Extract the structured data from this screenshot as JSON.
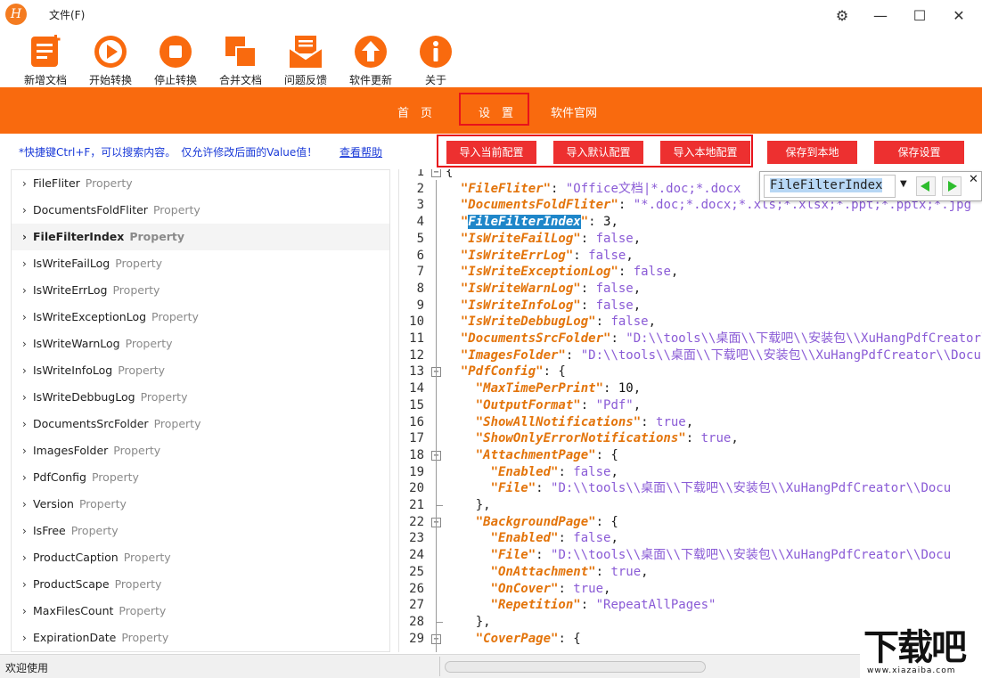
{
  "app": {
    "logo_letter": "H",
    "menu_file": "文件(F)"
  },
  "window": {
    "settings_glyph": "⚙",
    "minimize_glyph": "—",
    "maximize_glyph": "☐",
    "close_glyph": "✕"
  },
  "toolbar": {
    "items": [
      {
        "label": "新增文档",
        "icon": "new-doc-icon"
      },
      {
        "label": "开始转换",
        "icon": "play-icon"
      },
      {
        "label": "停止转换",
        "icon": "stop-icon"
      },
      {
        "label": "合并文档",
        "icon": "merge-icon"
      },
      {
        "label": "问题反馈",
        "icon": "feedback-icon"
      },
      {
        "label": "软件更新",
        "icon": "update-icon"
      },
      {
        "label": "关于",
        "icon": "info-icon"
      }
    ],
    "accent": "#f96a0e"
  },
  "nav": {
    "home": "首　页",
    "settings": "设　置",
    "website": "软件官网"
  },
  "info": {
    "hint": "*快捷键Ctrl+F，可以搜索内容。　仅允许修改后面的Value值！",
    "help_link": "查看帮助"
  },
  "buttons": {
    "import_current": "导入当前配置",
    "import_default": "导入默认配置",
    "import_local": "导入本地配置",
    "save_local": "保存到本地",
    "save_settings": "保存设置",
    "color": "#ed3030"
  },
  "properties": {
    "type_label": "Property",
    "chevron": "›",
    "selected_index": 2,
    "items": [
      "FileFliter",
      "DocumentsFoldFliter",
      "FileFilterIndex",
      "IsWriteFailLog",
      "IsWriteErrLog",
      "IsWriteExceptionLog",
      "IsWriteWarnLog",
      "IsWriteInfoLog",
      "IsWriteDebbugLog",
      "DocumentsSrcFolder",
      "ImagesFolder",
      "PdfConfig",
      "Version",
      "IsFree",
      "ProductCaption",
      "ProductScape",
      "MaxFilesCount",
      "ExpirationDate"
    ]
  },
  "editor": {
    "lines": [
      {
        "n": "1",
        "fold": "minus",
        "parts": [
          [
            "p",
            "{"
          ]
        ]
      },
      {
        "n": "2",
        "parts": [
          [
            "p",
            "  "
          ],
          [
            "k",
            "\"FileFliter\""
          ],
          [
            "p",
            ": "
          ],
          [
            "s",
            "\"Office文档|*.doc;*.docx"
          ]
        ]
      },
      {
        "n": "3",
        "parts": [
          [
            "p",
            "  "
          ],
          [
            "k",
            "\"DocumentsFoldFliter\""
          ],
          [
            "p",
            ": "
          ],
          [
            "s",
            "\"*.doc;*.docx;*.xls;*.xlsx;*.ppt;*.pptx;*.jpg"
          ]
        ]
      },
      {
        "n": "4",
        "parts": [
          [
            "p",
            "  "
          ],
          [
            "k",
            "\""
          ],
          [
            "h",
            "FileFilterIndex"
          ],
          [
            "k",
            "\""
          ],
          [
            "p",
            ": "
          ],
          [
            "n",
            "3"
          ],
          [
            "p",
            ","
          ]
        ]
      },
      {
        "n": "5",
        "parts": [
          [
            "p",
            "  "
          ],
          [
            "k",
            "\"IsWriteFailLog\""
          ],
          [
            "p",
            ": "
          ],
          [
            "w",
            "false"
          ],
          [
            "p",
            ","
          ]
        ]
      },
      {
        "n": "6",
        "parts": [
          [
            "p",
            "  "
          ],
          [
            "k",
            "\"IsWriteErrLog\""
          ],
          [
            "p",
            ": "
          ],
          [
            "w",
            "false"
          ],
          [
            "p",
            ","
          ]
        ]
      },
      {
        "n": "7",
        "parts": [
          [
            "p",
            "  "
          ],
          [
            "k",
            "\"IsWriteExceptionLog\""
          ],
          [
            "p",
            ": "
          ],
          [
            "w",
            "false"
          ],
          [
            "p",
            ","
          ]
        ]
      },
      {
        "n": "8",
        "parts": [
          [
            "p",
            "  "
          ],
          [
            "k",
            "\"IsWriteWarnLog\""
          ],
          [
            "p",
            ": "
          ],
          [
            "w",
            "false"
          ],
          [
            "p",
            ","
          ]
        ]
      },
      {
        "n": "9",
        "parts": [
          [
            "p",
            "  "
          ],
          [
            "k",
            "\"IsWriteInfoLog\""
          ],
          [
            "p",
            ": "
          ],
          [
            "w",
            "false"
          ],
          [
            "p",
            ","
          ]
        ]
      },
      {
        "n": "10",
        "parts": [
          [
            "p",
            "  "
          ],
          [
            "k",
            "\"IsWriteDebbugLog\""
          ],
          [
            "p",
            ": "
          ],
          [
            "w",
            "false"
          ],
          [
            "p",
            ","
          ]
        ]
      },
      {
        "n": "11",
        "parts": [
          [
            "p",
            "  "
          ],
          [
            "k",
            "\"DocumentsSrcFolder\""
          ],
          [
            "p",
            ": "
          ],
          [
            "s",
            "\"D:\\\\tools\\\\桌面\\\\下载吧\\\\安装包\\\\XuHangPdfCreator\\\\"
          ]
        ]
      },
      {
        "n": "12",
        "parts": [
          [
            "p",
            "  "
          ],
          [
            "k",
            "\"ImagesFolder\""
          ],
          [
            "p",
            ": "
          ],
          [
            "s",
            "\"D:\\\\tools\\\\桌面\\\\下载吧\\\\安装包\\\\XuHangPdfCreator\\\\Docu"
          ]
        ]
      },
      {
        "n": "13",
        "fold": "minus",
        "parts": [
          [
            "p",
            "  "
          ],
          [
            "k",
            "\"PdfConfig\""
          ],
          [
            "p",
            ": {"
          ]
        ]
      },
      {
        "n": "14",
        "parts": [
          [
            "p",
            "    "
          ],
          [
            "k",
            "\"MaxTimePerPrint\""
          ],
          [
            "p",
            ": "
          ],
          [
            "n",
            "10"
          ],
          [
            "p",
            ","
          ]
        ]
      },
      {
        "n": "15",
        "parts": [
          [
            "p",
            "    "
          ],
          [
            "k",
            "\"OutputFormat\""
          ],
          [
            "p",
            ": "
          ],
          [
            "s",
            "\"Pdf\""
          ],
          [
            "p",
            ","
          ]
        ]
      },
      {
        "n": "16",
        "parts": [
          [
            "p",
            "    "
          ],
          [
            "k",
            "\"ShowAllNotifications\""
          ],
          [
            "p",
            ": "
          ],
          [
            "w",
            "true"
          ],
          [
            "p",
            ","
          ]
        ]
      },
      {
        "n": "17",
        "parts": [
          [
            "p",
            "    "
          ],
          [
            "k",
            "\"ShowOnlyErrorNotifications\""
          ],
          [
            "p",
            ": "
          ],
          [
            "w",
            "true"
          ],
          [
            "p",
            ","
          ]
        ]
      },
      {
        "n": "18",
        "fold": "minus",
        "parts": [
          [
            "p",
            "    "
          ],
          [
            "k",
            "\"AttachmentPage\""
          ],
          [
            "p",
            ": {"
          ]
        ]
      },
      {
        "n": "19",
        "parts": [
          [
            "p",
            "      "
          ],
          [
            "k",
            "\"Enabled\""
          ],
          [
            "p",
            ": "
          ],
          [
            "w",
            "false"
          ],
          [
            "p",
            ","
          ]
        ]
      },
      {
        "n": "20",
        "parts": [
          [
            "p",
            "      "
          ],
          [
            "k",
            "\"File\""
          ],
          [
            "p",
            ": "
          ],
          [
            "s",
            "\"D:\\\\tools\\\\桌面\\\\下载吧\\\\安装包\\\\XuHangPdfCreator\\\\Docu"
          ]
        ]
      },
      {
        "n": "21",
        "fold": "end",
        "parts": [
          [
            "p",
            "    },"
          ]
        ]
      },
      {
        "n": "22",
        "fold": "minus",
        "parts": [
          [
            "p",
            "    "
          ],
          [
            "k",
            "\"BackgroundPage\""
          ],
          [
            "p",
            ": {"
          ]
        ]
      },
      {
        "n": "23",
        "parts": [
          [
            "p",
            "      "
          ],
          [
            "k",
            "\"Enabled\""
          ],
          [
            "p",
            ": "
          ],
          [
            "w",
            "false"
          ],
          [
            "p",
            ","
          ]
        ]
      },
      {
        "n": "24",
        "parts": [
          [
            "p",
            "      "
          ],
          [
            "k",
            "\"File\""
          ],
          [
            "p",
            ": "
          ],
          [
            "s",
            "\"D:\\\\tools\\\\桌面\\\\下载吧\\\\安装包\\\\XuHangPdfCreator\\\\Docu"
          ]
        ]
      },
      {
        "n": "25",
        "parts": [
          [
            "p",
            "      "
          ],
          [
            "k",
            "\"OnAttachment\""
          ],
          [
            "p",
            ": "
          ],
          [
            "w",
            "true"
          ],
          [
            "p",
            ","
          ]
        ]
      },
      {
        "n": "26",
        "parts": [
          [
            "p",
            "      "
          ],
          [
            "k",
            "\"OnCover\""
          ],
          [
            "p",
            ": "
          ],
          [
            "w",
            "true"
          ],
          [
            "p",
            ","
          ]
        ]
      },
      {
        "n": "27",
        "parts": [
          [
            "p",
            "      "
          ],
          [
            "k",
            "\"Repetition\""
          ],
          [
            "p",
            ": "
          ],
          [
            "s",
            "\"RepeatAllPages\""
          ]
        ]
      },
      {
        "n": "28",
        "fold": "end",
        "parts": [
          [
            "p",
            "    },"
          ]
        ]
      },
      {
        "n": "29",
        "fold": "minus",
        "parts": [
          [
            "p",
            "    "
          ],
          [
            "k",
            "\"CoverPage\""
          ],
          [
            "p",
            ": {"
          ]
        ]
      }
    ]
  },
  "find": {
    "value": "FileFilterIndex",
    "dropdown_glyph": "▼",
    "close_glyph": "✕"
  },
  "status": {
    "text": "欢迎使用",
    "progress": 0
  },
  "watermark": {
    "big": "下载吧",
    "small": "www.xiazaiba.com"
  }
}
